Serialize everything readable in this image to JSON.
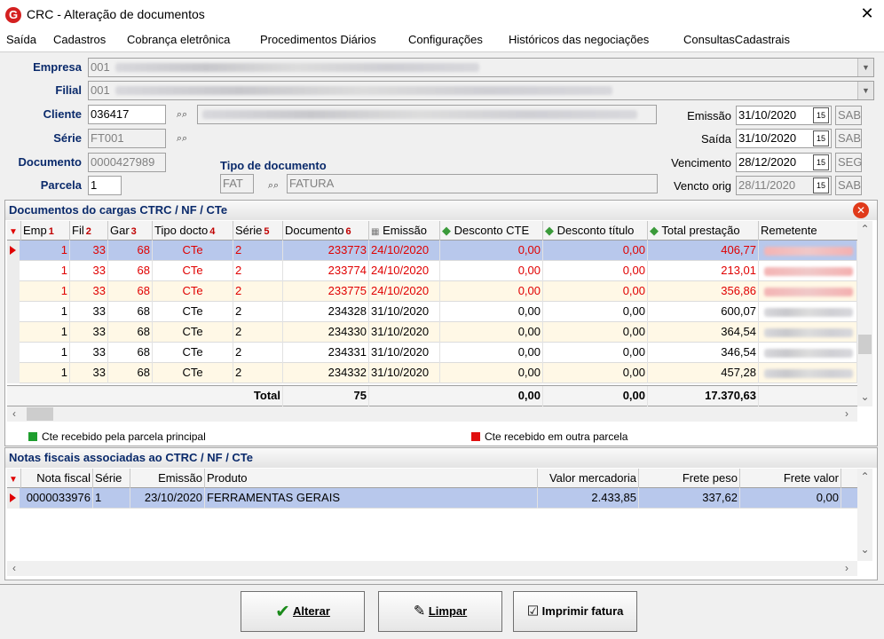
{
  "window": {
    "title": "CRC - Alteração de documentos",
    "app_icon": "G"
  },
  "menu": [
    "Saída",
    "Cadastros",
    "Cobrança eletrônica",
    "Procedimentos Diários",
    "Configurações",
    "Históricos das negociações",
    "ConsultasCadastrais"
  ],
  "form": {
    "empresa_label": "Empresa",
    "empresa_code": "001",
    "filial_label": "Filial",
    "filial_code": "001",
    "cliente_label": "Cliente",
    "cliente_value": "036417",
    "serie_label": "Série",
    "serie_value": "FT001",
    "documento_label": "Documento",
    "documento_value": "0000427989",
    "parcela_label": "Parcela",
    "parcela_value": "1",
    "tipo_doc_label": "Tipo de documento",
    "tipo_doc_code": "FAT",
    "tipo_doc_desc": "FATURA",
    "emissao_label": "Emissão",
    "emissao_value": "31/10/2020",
    "emissao_day": "SAB",
    "saida_label": "Saída",
    "saida_value": "31/10/2020",
    "saida_day": "SAB",
    "vencimento_label": "Vencimento",
    "vencimento_value": "28/12/2020",
    "vencimento_day": "SEG",
    "vencto_orig_label": "Vencto orig",
    "vencto_orig_value": "28/11/2020",
    "vencto_orig_day": "SAB"
  },
  "docs_panel": {
    "title": "Documentos do cargas CTRC / NF / CTe",
    "columns": [
      "Emp",
      "Fil",
      "Gar",
      "Tipo docto",
      "Série",
      "Documento",
      "Emissão",
      "Desconto CTE",
      "Desconto título",
      "Total prestação",
      "Remetente"
    ],
    "sort_marks": [
      "1",
      "2",
      "3",
      "4",
      "5",
      "6"
    ],
    "rows": [
      {
        "emp": "1",
        "fil": "33",
        "gar": "68",
        "tipo": "CTe",
        "serie": "2",
        "documento": "233773",
        "emissao": "24/10/2020",
        "desc_cte": "0,00",
        "desc_titulo": "0,00",
        "total": "406,77",
        "red": true,
        "selected": true
      },
      {
        "emp": "1",
        "fil": "33",
        "gar": "68",
        "tipo": "CTe",
        "serie": "2",
        "documento": "233774",
        "emissao": "24/10/2020",
        "desc_cte": "0,00",
        "desc_titulo": "0,00",
        "total": "213,01",
        "red": true,
        "selected": false
      },
      {
        "emp": "1",
        "fil": "33",
        "gar": "68",
        "tipo": "CTe",
        "serie": "2",
        "documento": "233775",
        "emissao": "24/10/2020",
        "desc_cte": "0,00",
        "desc_titulo": "0,00",
        "total": "356,86",
        "red": true,
        "selected": false
      },
      {
        "emp": "1",
        "fil": "33",
        "gar": "68",
        "tipo": "CTe",
        "serie": "2",
        "documento": "234328",
        "emissao": "31/10/2020",
        "desc_cte": "0,00",
        "desc_titulo": "0,00",
        "total": "600,07",
        "red": false,
        "selected": false
      },
      {
        "emp": "1",
        "fil": "33",
        "gar": "68",
        "tipo": "CTe",
        "serie": "2",
        "documento": "234330",
        "emissao": "31/10/2020",
        "desc_cte": "0,00",
        "desc_titulo": "0,00",
        "total": "364,54",
        "red": false,
        "selected": false
      },
      {
        "emp": "1",
        "fil": "33",
        "gar": "68",
        "tipo": "CTe",
        "serie": "2",
        "documento": "234331",
        "emissao": "31/10/2020",
        "desc_cte": "0,00",
        "desc_titulo": "0,00",
        "total": "346,54",
        "red": false,
        "selected": false
      },
      {
        "emp": "1",
        "fil": "33",
        "gar": "68",
        "tipo": "CTe",
        "serie": "2",
        "documento": "234332",
        "emissao": "31/10/2020",
        "desc_cte": "0,00",
        "desc_titulo": "0,00",
        "total": "457,28",
        "red": false,
        "selected": false
      }
    ],
    "totals": {
      "label": "Total",
      "count": "75",
      "desc_cte": "0,00",
      "desc_titulo": "0,00",
      "total": "17.370,63"
    },
    "legend_green": "Cte recebido pela parcela principal",
    "legend_red": "Cte recebido em outra parcela",
    "colors": {
      "green": "#1e9e2e",
      "red": "#e01010",
      "row_red_text": "#e00000",
      "selected_bg": "#b8c8ec",
      "odd_bg": "#fff8e6"
    }
  },
  "nf_panel": {
    "title": "Notas fiscais associadas ao CTRC / NF / CTe",
    "columns": [
      "Nota fiscal",
      "Série",
      "Emissão",
      "Produto",
      "Valor mercadoria",
      "Frete peso",
      "Frete valor"
    ],
    "rows": [
      {
        "nota": "0000033976",
        "serie": "1",
        "emissao": "23/10/2020",
        "produto": "FERRAMENTAS GERAIS",
        "valor": "2.433,85",
        "frete_peso": "337,62",
        "frete_valor": "0,00"
      }
    ]
  },
  "buttons": {
    "alterar": "Alterar",
    "limpar": "Limpar",
    "imprimir": "Imprimir fatura"
  }
}
